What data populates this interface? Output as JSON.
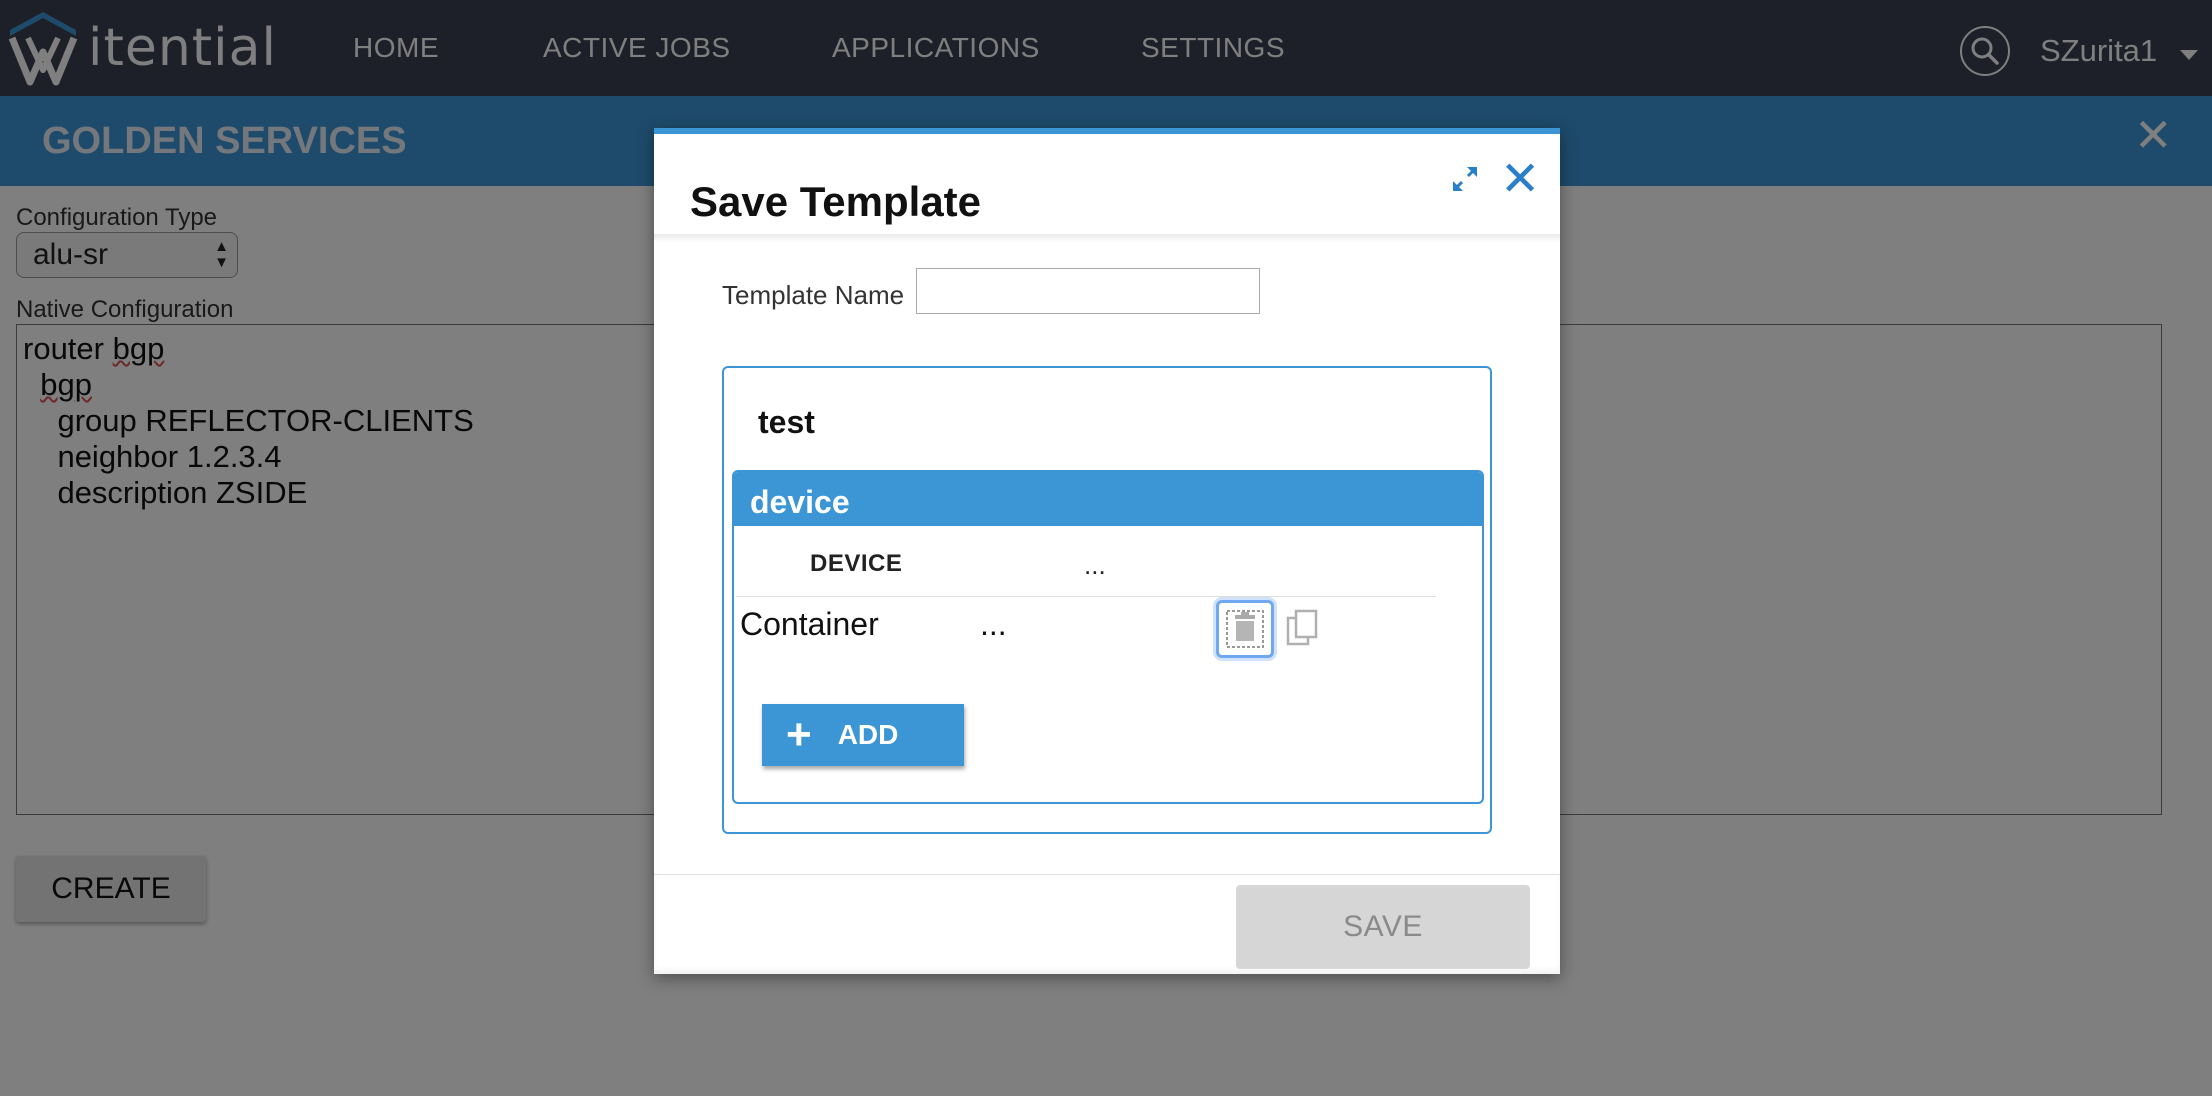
{
  "app": {
    "logo_text": "itential",
    "nav": [
      "HOME",
      "ACTIVE JOBS",
      "APPLICATIONS",
      "SETTINGS"
    ],
    "user": "SZurita1",
    "accent_color": "#3c96d6",
    "nav_bg_color": "#3a4150"
  },
  "page": {
    "title": "GOLDEN SERVICES",
    "close_icon": "close-icon",
    "config_type_label": "Configuration Type",
    "config_type_value": "alu-sr",
    "native_config_label": "Native Configuration",
    "native_config_lines": [
      "router bgp",
      "  bgp",
      "    group REFLECTOR-CLIENTS",
      "    neighbor 1.2.3.4",
      "    description ZSIDE"
    ],
    "create_label": "CREATE"
  },
  "modal": {
    "title": "Save Template",
    "template_name_label": "Template Name",
    "template_name_value": "",
    "group_title": "test",
    "section_title": "device",
    "columns": [
      "DEVICE",
      "..."
    ],
    "rows": [
      {
        "name": "Container",
        "value": "..."
      }
    ],
    "add_label": "ADD",
    "save_label": "SAVE"
  }
}
